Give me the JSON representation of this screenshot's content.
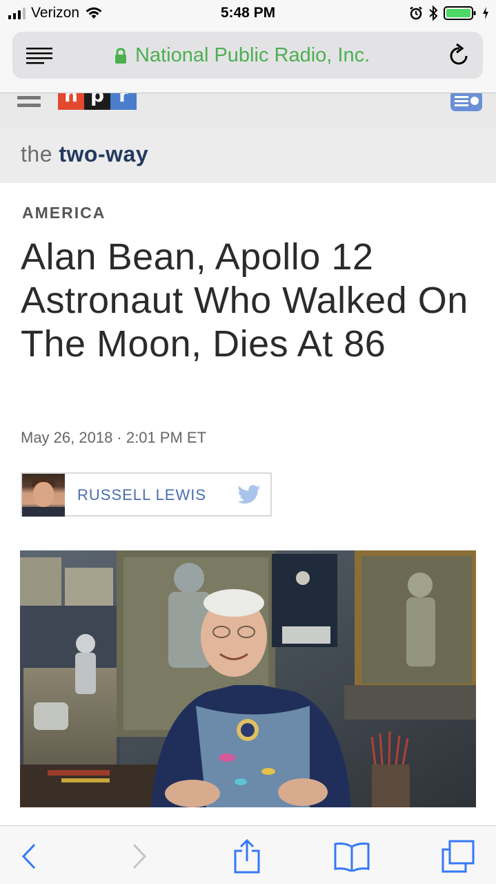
{
  "status_bar": {
    "carrier": "Verizon",
    "time": "5:48 PM",
    "signal_bars": 3,
    "battery_level": 0.9,
    "icons": [
      "signal-icon",
      "wifi-icon",
      "alarm-icon",
      "bluetooth-icon",
      "battery-icon",
      "charging-icon"
    ]
  },
  "browser": {
    "url_label": "National Public Radio, Inc.",
    "secure": true,
    "icons": [
      "reader-mode-icon",
      "lock-icon",
      "reload-icon"
    ]
  },
  "site_header": {
    "logo_letters": [
      "n",
      "p",
      "r"
    ],
    "logo_colors": [
      "#e2492f",
      "#1c1c1c",
      "#4a7dcc"
    ],
    "icons": [
      "hamburger-menu-icon",
      "radio-player-icon"
    ]
  },
  "section_banner": {
    "prefix": "the",
    "name": "two-way"
  },
  "article": {
    "kicker": "AMERICA",
    "headline": "Alan Bean, Apollo 12 Astronaut Who Walked On The Moon, Dies At 86",
    "dateline": "May 26, 2018 · 2:01 PM ET",
    "author": {
      "name": "RUSSELL LEWIS",
      "icons": [
        "author-avatar",
        "twitter-icon"
      ]
    },
    "photo_description_visible": false
  },
  "toolbar": {
    "icons": [
      "back-icon",
      "forward-icon",
      "share-icon",
      "bookmarks-icon",
      "tabs-icon"
    ],
    "forward_enabled": false
  },
  "colors": {
    "accent_link": "#4a6eb0",
    "url_green": "#4caf50",
    "ios_blue": "#3478f6",
    "banner_navy": "#233a5f"
  }
}
